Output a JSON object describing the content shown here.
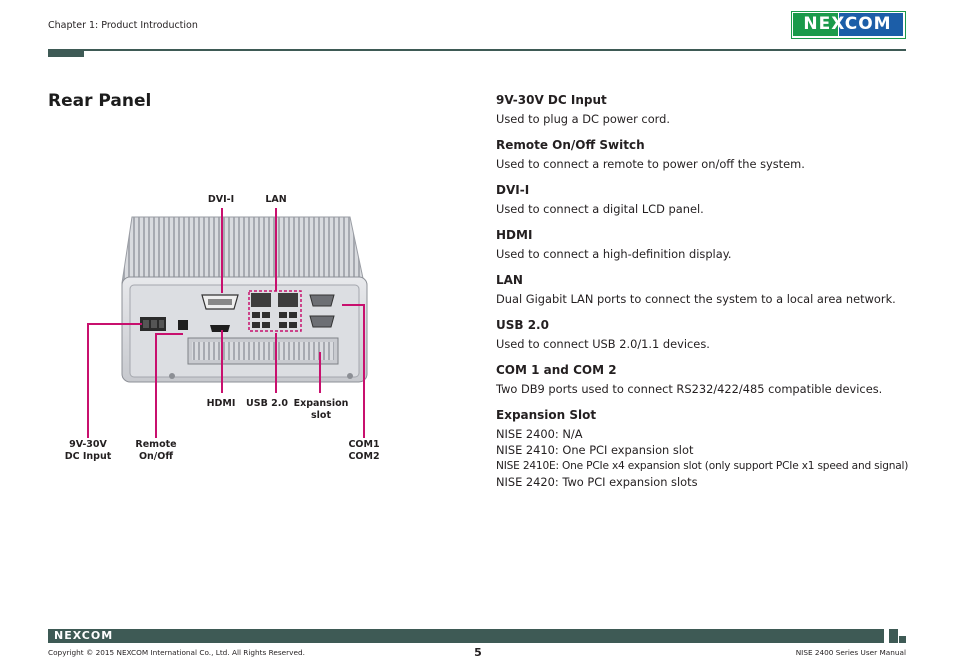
{
  "header": {
    "chapter": "Chapter 1: Product Introduction",
    "logo_text": "NEXCOM"
  },
  "left": {
    "title": "Rear Panel",
    "callouts": {
      "dvi": "DVI-I",
      "lan": "LAN",
      "hdmi": "HDMI",
      "usb": "USB 2.0",
      "expansion_1": "Expansion",
      "expansion_2": "slot",
      "dc_1": "9V-30V",
      "dc_2": "DC Input",
      "remote_1": "Remote",
      "remote_2": "On/Off",
      "com_1": "COM1",
      "com_2": "COM2"
    }
  },
  "right": {
    "items": [
      {
        "heading": "9V-30V DC Input",
        "text": "Used to plug a DC power cord."
      },
      {
        "heading": "Remote On/Off Switch",
        "text": "Used to connect a remote to power on/off the system."
      },
      {
        "heading": "DVI-I",
        "text": "Used to connect a digital LCD panel."
      },
      {
        "heading": "HDMI",
        "text": "Used to connect a high-definition display."
      },
      {
        "heading": "LAN",
        "text": "Dual Gigabit LAN ports to connect the system to a local area network."
      },
      {
        "heading": "USB 2.0",
        "text": "Used to connect USB 2.0/1.1 devices."
      },
      {
        "heading": "COM 1 and COM 2",
        "text": "Two DB9 ports used to connect RS232/422/485 compatible devices."
      }
    ],
    "expansion": {
      "heading": "Expansion Slot",
      "lines": [
        "NISE 2400: N/A",
        "NISE 2410: One PCI expansion slot",
        "NISE 2410E: One PCIe x4 expansion slot (only support PCIe x1 speed and signal)",
        "NISE 2420: Two PCI expansion slots"
      ]
    }
  },
  "footer": {
    "logo_text": "NEXCOM",
    "copyright": "Copyright © 2015 NEXCOM International Co., Ltd. All Rights Reserved.",
    "page": "5",
    "manual": "NISE 2400 Series User Manual"
  },
  "colors": {
    "accent_dark": "#3e5a55",
    "callout_line": "#c8106e",
    "logo_green": "#1a9a4a",
    "logo_blue": "#1c5ea8"
  }
}
